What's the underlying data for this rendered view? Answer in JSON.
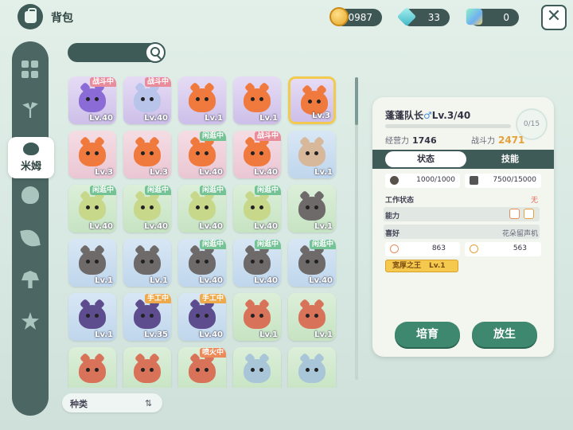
{
  "header": {
    "title": "背包"
  },
  "currencies": [
    {
      "name": "coin",
      "value": "40987",
      "color": "#e5a526"
    },
    {
      "name": "gem",
      "value": "33",
      "color": "#3fb6c7"
    },
    {
      "name": "crystal",
      "value": "0",
      "color": "#6fb0f0"
    }
  ],
  "sidebar": {
    "active_label": "米姆"
  },
  "sort": {
    "label": "种类"
  },
  "pets": [
    {
      "level": "Lv.40",
      "tag": "战斗中",
      "tag_type": "fight",
      "bg": "purple",
      "color": "#8b6bd6"
    },
    {
      "level": "Lv.40",
      "tag": "战斗中",
      "tag_type": "fight",
      "bg": "purple",
      "color": "#b8c4ea"
    },
    {
      "level": "Lv.1",
      "tag": "",
      "tag_type": "",
      "bg": "purple",
      "color": "#f07a3e"
    },
    {
      "level": "Lv.1",
      "tag": "",
      "tag_type": "",
      "bg": "purple",
      "color": "#f07a3e"
    },
    {
      "level": "Lv.3",
      "tag": "",
      "tag_type": "",
      "bg": "purple",
      "color": "#f07a3e",
      "selected": true
    },
    {
      "level": "Lv.3",
      "tag": "",
      "tag_type": "",
      "bg": "pink",
      "color": "#f07a3e"
    },
    {
      "level": "Lv.3",
      "tag": "",
      "tag_type": "",
      "bg": "pink",
      "color": "#f07a3e"
    },
    {
      "level": "Lv.40",
      "tag": "闲逛中",
      "tag_type": "idle",
      "bg": "pink",
      "color": "#f07a3e"
    },
    {
      "level": "Lv.40",
      "tag": "战斗中",
      "tag_type": "fight",
      "bg": "pink",
      "color": "#f07a3e"
    },
    {
      "level": "Lv.1",
      "tag": "",
      "tag_type": "",
      "bg": "blue",
      "color": "#d7b89a"
    },
    {
      "level": "Lv.40",
      "tag": "闲逛中",
      "tag_type": "idle",
      "bg": "green",
      "color": "#c8d88a"
    },
    {
      "level": "Lv.40",
      "tag": "闲逛中",
      "tag_type": "idle",
      "bg": "green",
      "color": "#c8d88a"
    },
    {
      "level": "Lv.40",
      "tag": "闲逛中",
      "tag_type": "idle",
      "bg": "green",
      "color": "#c8d88a"
    },
    {
      "level": "Lv.40",
      "tag": "闲逛中",
      "tag_type": "idle",
      "bg": "green",
      "color": "#c8d88a"
    },
    {
      "level": "Lv.1",
      "tag": "",
      "tag_type": "",
      "bg": "green",
      "color": "#6e6a6a"
    },
    {
      "level": "Lv.1",
      "tag": "",
      "tag_type": "",
      "bg": "blue",
      "color": "#6e6a6a"
    },
    {
      "level": "Lv.1",
      "tag": "",
      "tag_type": "",
      "bg": "blue",
      "color": "#6e6a6a"
    },
    {
      "level": "Lv.40",
      "tag": "闲逛中",
      "tag_type": "idle",
      "bg": "blue",
      "color": "#6e6a6a"
    },
    {
      "level": "Lv.40",
      "tag": "闲逛中",
      "tag_type": "idle",
      "bg": "blue",
      "color": "#6e6a6a"
    },
    {
      "level": "Lv.40",
      "tag": "闲逛中",
      "tag_type": "idle",
      "bg": "blue",
      "color": "#6e6a6a"
    },
    {
      "level": "Lv.1",
      "tag": "",
      "tag_type": "",
      "bg": "blue",
      "color": "#5d4c8e"
    },
    {
      "level": "Lv.35",
      "tag": "手工中",
      "tag_type": "work",
      "bg": "blue",
      "color": "#5d4c8e"
    },
    {
      "level": "Lv.40",
      "tag": "手工中",
      "tag_type": "work",
      "bg": "blue",
      "color": "#5d4c8e"
    },
    {
      "level": "Lv.1",
      "tag": "",
      "tag_type": "",
      "bg": "green",
      "color": "#d8735a"
    },
    {
      "level": "Lv.1",
      "tag": "",
      "tag_type": "",
      "bg": "green",
      "color": "#d8735a"
    },
    {
      "level": "",
      "tag": "",
      "tag_type": "",
      "bg": "green",
      "color": "#d8735a"
    },
    {
      "level": "",
      "tag": "",
      "tag_type": "",
      "bg": "green",
      "color": "#d8735a"
    },
    {
      "level": "",
      "tag": "喷火中",
      "tag_type": "fire",
      "bg": "green",
      "color": "#d8735a"
    },
    {
      "level": "",
      "tag": "",
      "tag_type": "",
      "bg": "green",
      "color": "#a9c6d8"
    },
    {
      "level": "",
      "tag": "",
      "tag_type": "",
      "bg": "green",
      "color": "#a9c6d8"
    }
  ],
  "detail": {
    "name": "蓬蓬队长",
    "gender": "♂",
    "level": "Lv.3/40",
    "count": "0/15",
    "experience_label": "经营力",
    "experience_value": "1746",
    "power_label": "战斗力",
    "power_value": "2471",
    "tab_status": "状态",
    "tab_skill": "技能",
    "stat1": "1000/1000",
    "stat2": "7500/15000",
    "work_label": "工作状态",
    "work_value": "无",
    "ability_label": "能力",
    "hobby_label": "喜好",
    "hobby_value": "花朵留声机",
    "attr1": "863",
    "attr2": "563",
    "trait_name": "宽厚之王",
    "trait_level": "Lv.1",
    "button_train": "培育",
    "button_release": "放生"
  }
}
